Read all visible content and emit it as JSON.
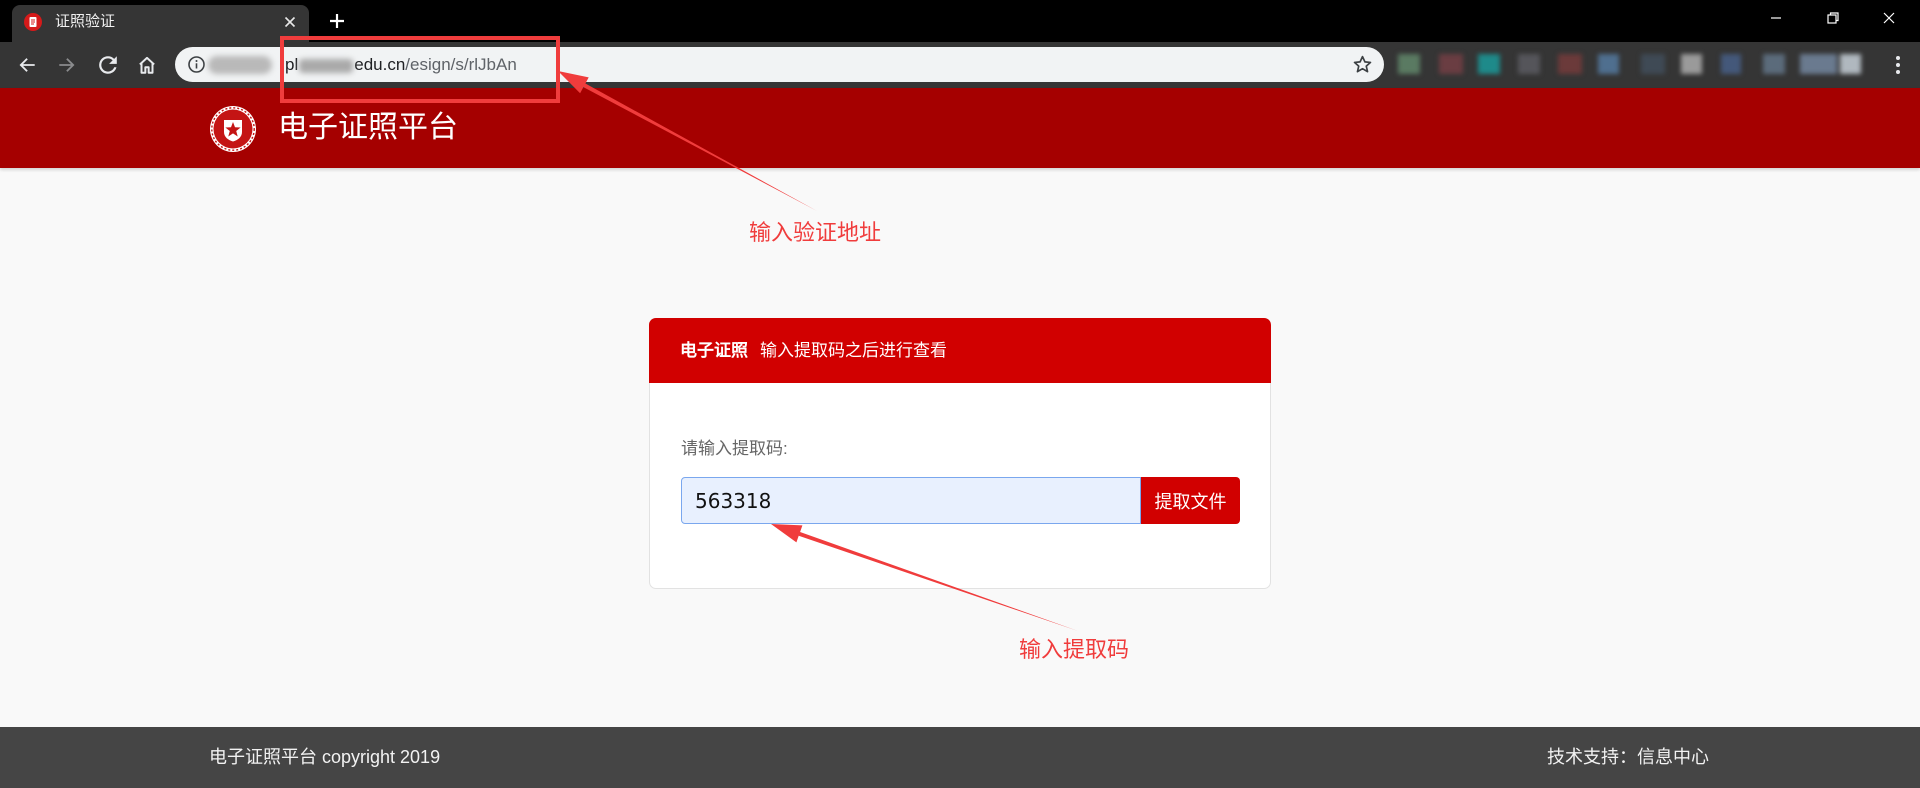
{
  "browser": {
    "tab": {
      "title": "证照验证",
      "favicon": "document-favicon-icon"
    },
    "address_bar": {
      "host_start": "pl",
      "host_end": "edu.cn",
      "path": "/esign/s/rlJbAn"
    },
    "toolbar_icons": [
      "back-arrow-icon",
      "forward-arrow-icon",
      "reload-icon",
      "home-icon",
      "site-info-icon",
      "bookmark-star-icon",
      "menu-dots-icon"
    ],
    "window_controls": [
      "minimize-icon",
      "restore-icon",
      "close-icon"
    ]
  },
  "header": {
    "title": "电子证照平台",
    "logo": "seal-star-logo-icon"
  },
  "card": {
    "header_bold": "电子证照",
    "header_text": "输入提取码之后进行查看",
    "label": "请输入提取码:",
    "input_value": "563318",
    "submit_label": "提取文件"
  },
  "annotations": {
    "url_note": "输入验证地址",
    "code_note": "输入提取码"
  },
  "footer": {
    "left": "电子证照平台 copyright 2019",
    "right": "技术支持：信息中心"
  },
  "colors": {
    "header_red": "#a50000",
    "card_red": "#d10000",
    "annotation_red": "#f03c3c",
    "footer_gray": "#454545",
    "input_bg": "#e8f0fe",
    "input_border": "#7aa7ee",
    "page_bg": "#f9f9f9"
  }
}
